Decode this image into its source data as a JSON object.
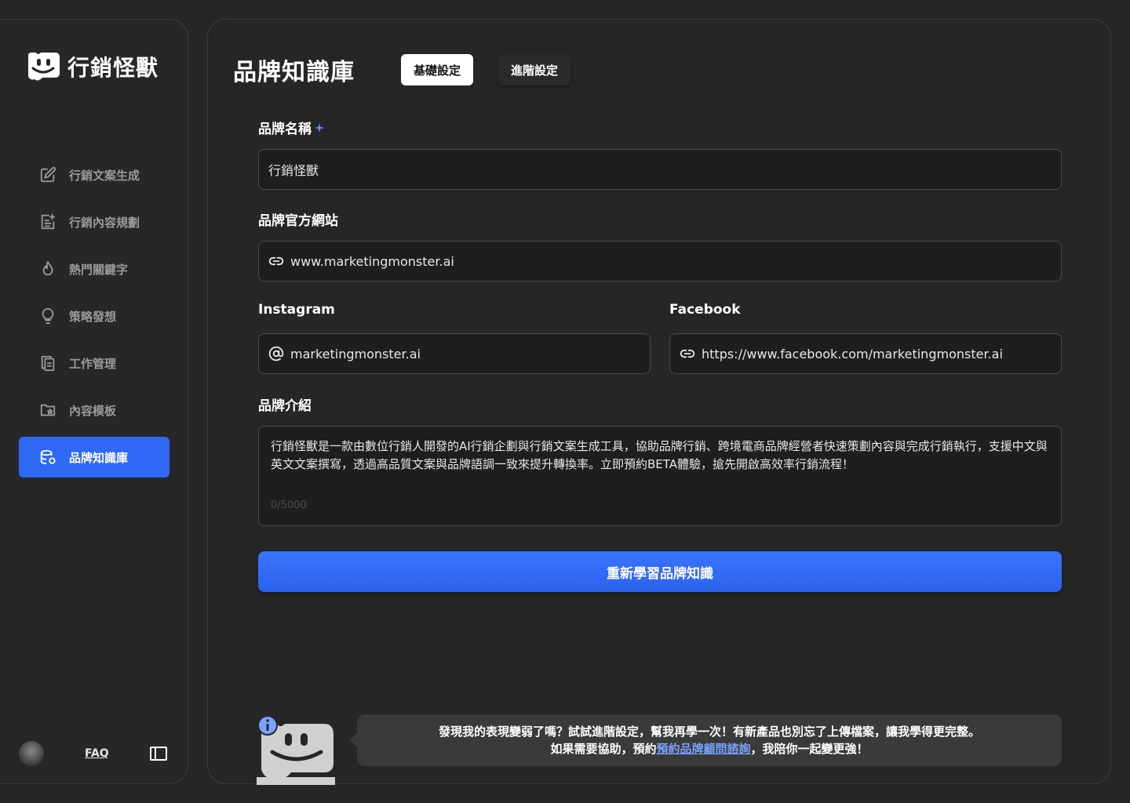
{
  "brand": {
    "name": "行銷怪獸"
  },
  "sidebar": {
    "items": [
      {
        "label": "行銷文案生成",
        "icon": "edit-icon"
      },
      {
        "label": "行銷內容規劃",
        "icon": "plan-icon"
      },
      {
        "label": "熱門關鍵字",
        "icon": "flame-icon"
      },
      {
        "label": "策略發想",
        "icon": "lightbulb-icon"
      },
      {
        "label": "工作管理",
        "icon": "copy-icon"
      },
      {
        "label": "內容模板",
        "icon": "folder-star-icon"
      },
      {
        "label": "品牌知識庫",
        "icon": "database-icon",
        "active": true
      }
    ],
    "faq_label": "FAQ"
  },
  "main": {
    "title": "品牌知識庫",
    "tabs": [
      {
        "label": "基礎設定",
        "active": true
      },
      {
        "label": "進階設定",
        "active": false
      }
    ],
    "form": {
      "brand_name": {
        "label": "品牌名稱",
        "value": "行銷怪獸"
      },
      "website": {
        "label": "品牌官方網站",
        "value": "www.marketingmonster.ai"
      },
      "instagram": {
        "label": "Instagram",
        "value": "marketingmonster.ai"
      },
      "facebook": {
        "label": "Facebook",
        "value": "https://www.facebook.com/marketingmonster.ai"
      },
      "intro": {
        "label": "品牌介紹",
        "value": "行銷怪獸是一款由數位行銷人開發的AI行銷企劃與行銷文案生成工具，協助品牌行銷、跨境電商品牌經營者快速策劃內容與完成行銷執行，支援中文與英文文案撰寫，透過高品質文案與品牌語調一致來提升轉換率。立即預約BETA體驗，搶先開啟高效率行銷流程！",
        "counter": "0/5000"
      }
    },
    "relearn_button": "重新學習品牌知識",
    "tip": {
      "line1": "發現我的表現變弱了嗎？試試進階設定，幫我再學一次！有新產品也別忘了上傳檔案，讓我學得更完整。",
      "line2_prefix": "如果需要協助，預約",
      "line2_link": "預約品牌顧問諮詢",
      "line2_suffix": "，我陪你一起變更強！"
    }
  },
  "colors": {
    "accent": "#2f68f4",
    "background": "#262626",
    "field": "#1e1e1e"
  }
}
